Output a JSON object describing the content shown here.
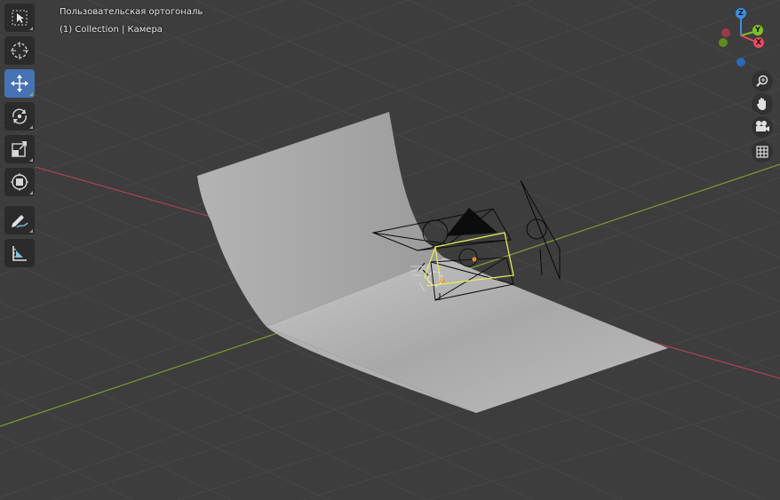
{
  "viewport": {
    "view_name": "Пользовательская ортогональ",
    "collection_info": "(1) Collection | Камера"
  },
  "toolbar": {
    "tools": [
      {
        "name": "select-box",
        "icon": "select-box-icon",
        "active": false
      },
      {
        "name": "cursor",
        "icon": "cursor-icon",
        "active": false
      },
      {
        "name": "move",
        "icon": "move-icon",
        "active": true
      },
      {
        "name": "rotate",
        "icon": "rotate-icon",
        "active": false
      },
      {
        "name": "scale",
        "icon": "scale-icon",
        "active": false
      },
      {
        "name": "transform",
        "icon": "transform-icon",
        "active": false
      },
      {
        "name": "annotate",
        "icon": "annotate-icon",
        "active": false
      },
      {
        "name": "measure",
        "icon": "measure-icon",
        "active": false
      }
    ]
  },
  "navigation_gizmo": {
    "axes": {
      "x": "X",
      "y": "Y",
      "z": "Z"
    },
    "colors": {
      "x": "#e84a5f",
      "y": "#7fbf26",
      "z": "#3a8fe8"
    }
  },
  "navigation_buttons": [
    "zoom-icon",
    "hand-pan-icon",
    "camera-view-icon",
    "grid-view-icon"
  ],
  "colors": {
    "background": "#3d3d3d",
    "grid": "#474747",
    "x_axis": "#a8444f",
    "y_axis": "#7c9a36",
    "backdrop": "#b8b8b8",
    "selected_camera": "#e6e85c",
    "active_tool": "#4772b3"
  }
}
